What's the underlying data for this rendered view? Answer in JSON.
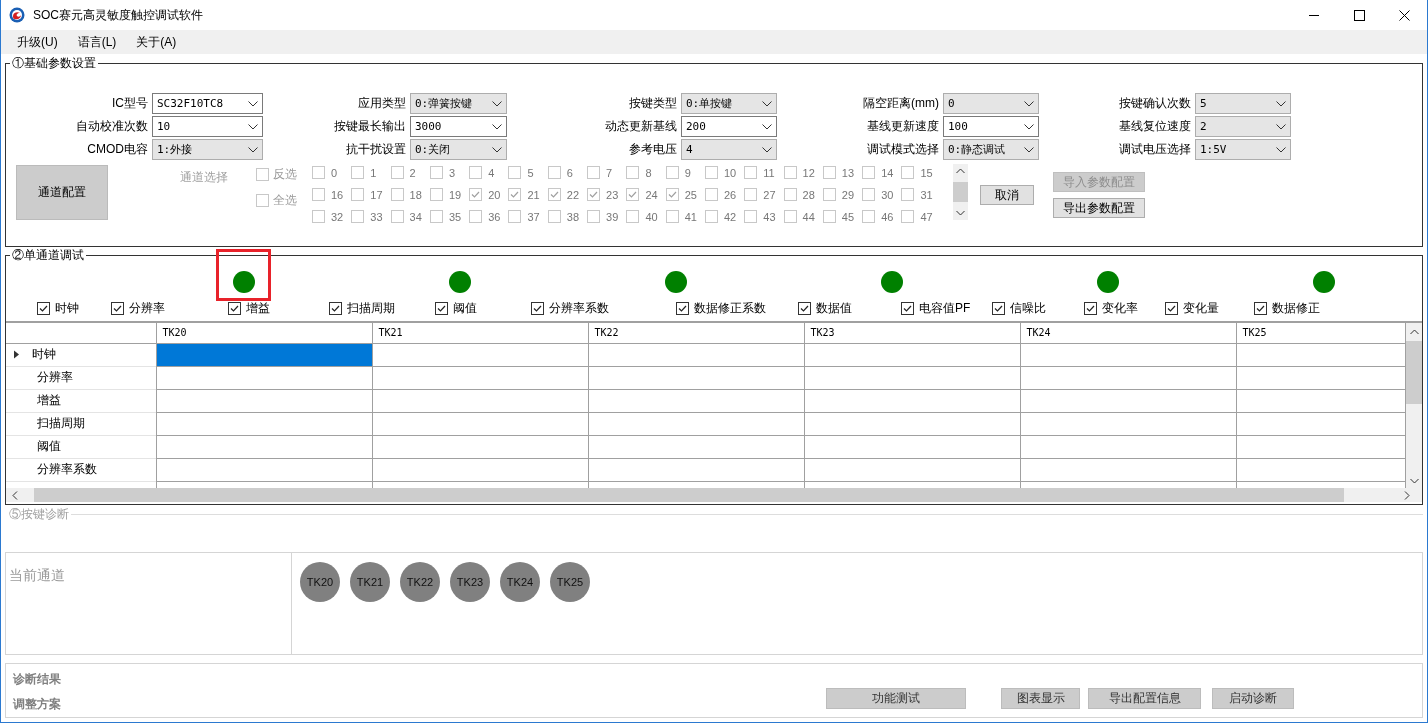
{
  "window": {
    "title": "SOC赛元高灵敏度触控调试软件"
  },
  "menu": [
    {
      "label": "升级(U)"
    },
    {
      "label": "语言(L)"
    },
    {
      "label": "关于(A)"
    }
  ],
  "basic_params": {
    "title": "①基础参数设置",
    "field_columns": [
      [
        {
          "label": "IC型号",
          "value": "SC32F10TC8",
          "editable": true
        },
        {
          "label": "自动校准次数",
          "value": "10",
          "editable": true
        },
        {
          "label": "CMOD电容",
          "value": "1:外接",
          "editable": false
        }
      ],
      [
        {
          "label": "应用类型",
          "value": "0:弹簧按键",
          "editable": false
        },
        {
          "label": "按键最长输出",
          "value": "3000",
          "editable": true
        },
        {
          "label": "抗干扰设置",
          "value": "0:关闭",
          "editable": false
        }
      ],
      [
        {
          "label": "按键类型",
          "value": "0:单按键",
          "editable": false
        },
        {
          "label": "动态更新基线",
          "value": "200",
          "editable": true
        },
        {
          "label": "参考电压",
          "value": "4",
          "editable": false
        }
      ],
      [
        {
          "label": "隔空距离(mm)",
          "value": "0",
          "editable": false
        },
        {
          "label": "基线更新速度",
          "value": "100",
          "editable": true
        },
        {
          "label": "调试模式选择",
          "value": "0:静态调试",
          "editable": false
        }
      ],
      [
        {
          "label": "按键确认次数",
          "value": "5",
          "editable": false
        },
        {
          "label": "基线复位速度",
          "value": "2",
          "editable": false
        },
        {
          "label": "调试电压选择",
          "value": "1:5V",
          "editable": false
        }
      ]
    ],
    "config_button": "通道配置",
    "channel_select_label": "通道选择",
    "select_options": [
      {
        "label": "反选",
        "checked": false,
        "disabled": true
      },
      {
        "label": "全选",
        "checked": false,
        "disabled": true
      }
    ],
    "channels": [
      {
        "label": "0",
        "checked": false
      },
      {
        "label": "1",
        "checked": false
      },
      {
        "label": "2",
        "checked": false
      },
      {
        "label": "3",
        "checked": false
      },
      {
        "label": "4",
        "checked": false
      },
      {
        "label": "5",
        "checked": false
      },
      {
        "label": "6",
        "checked": false
      },
      {
        "label": "7",
        "checked": false
      },
      {
        "label": "8",
        "checked": false
      },
      {
        "label": "9",
        "checked": false
      },
      {
        "label": "10",
        "checked": false
      },
      {
        "label": "11",
        "checked": false
      },
      {
        "label": "12",
        "checked": false
      },
      {
        "label": "13",
        "checked": false
      },
      {
        "label": "14",
        "checked": false
      },
      {
        "label": "15",
        "checked": false
      },
      {
        "label": "16",
        "checked": false
      },
      {
        "label": "17",
        "checked": false
      },
      {
        "label": "18",
        "checked": false
      },
      {
        "label": "19",
        "checked": false
      },
      {
        "label": "20",
        "checked": true
      },
      {
        "label": "21",
        "checked": true
      },
      {
        "label": "22",
        "checked": true
      },
      {
        "label": "23",
        "checked": true
      },
      {
        "label": "24",
        "checked": true
      },
      {
        "label": "25",
        "checked": true
      },
      {
        "label": "26",
        "checked": false
      },
      {
        "label": "27",
        "checked": false
      },
      {
        "label": "28",
        "checked": false
      },
      {
        "label": "29",
        "checked": false
      },
      {
        "label": "30",
        "checked": false
      },
      {
        "label": "31",
        "checked": false
      },
      {
        "label": "32",
        "checked": false
      },
      {
        "label": "33",
        "checked": false
      },
      {
        "label": "34",
        "checked": false
      },
      {
        "label": "35",
        "checked": false
      },
      {
        "label": "36",
        "checked": false
      },
      {
        "label": "37",
        "checked": false
      },
      {
        "label": "38",
        "checked": false
      },
      {
        "label": "39",
        "checked": false
      },
      {
        "label": "40",
        "checked": false
      },
      {
        "label": "41",
        "checked": false
      },
      {
        "label": "42",
        "checked": false
      },
      {
        "label": "43",
        "checked": false
      },
      {
        "label": "44",
        "checked": false
      },
      {
        "label": "45",
        "checked": false
      },
      {
        "label": "46",
        "checked": false
      },
      {
        "label": "47",
        "checked": false
      }
    ],
    "cancel_button": {
      "label": "取消",
      "disabled": false
    },
    "import_button": {
      "label": "导入参数配置",
      "disabled": true
    },
    "export_button": {
      "label": "导出参数配置",
      "disabled": false
    }
  },
  "single_channel_debug": {
    "title": "②单通道调试",
    "indicators": [
      {
        "on": true,
        "highlighted": true
      },
      {
        "on": true,
        "highlighted": false
      },
      {
        "on": true,
        "highlighted": false
      },
      {
        "on": true,
        "highlighted": false
      },
      {
        "on": true,
        "highlighted": false
      },
      {
        "on": true,
        "highlighted": false
      }
    ],
    "options": [
      {
        "label": "时钟",
        "checked": true
      },
      {
        "label": "分辨率",
        "checked": true
      },
      {
        "label": "增益",
        "checked": true
      },
      {
        "label": "扫描周期",
        "checked": true
      },
      {
        "label": "阈值",
        "checked": true
      },
      {
        "label": "分辨率系数",
        "checked": true
      },
      {
        "label": "数据修正系数",
        "checked": true
      },
      {
        "label": "数据值",
        "checked": true
      },
      {
        "label": "电容值PF",
        "checked": true
      },
      {
        "label": "信噪比",
        "checked": true
      },
      {
        "label": "变化率",
        "checked": true
      },
      {
        "label": "变化量",
        "checked": true
      },
      {
        "label": "数据修正",
        "checked": true
      }
    ],
    "table": {
      "columns": [
        "TK20",
        "TK21",
        "TK22",
        "TK23",
        "TK24",
        "TK25"
      ],
      "rows": [
        {
          "label": "时钟",
          "selected": true,
          "cells": [
            {
              "selected": true
            },
            {
              "selected": false
            },
            {
              "selected": false
            },
            {
              "selected": false
            },
            {
              "selected": false
            },
            {
              "selected": false
            }
          ]
        },
        {
          "label": "分辨率",
          "selected": false,
          "cells": [
            {
              "selected": false
            },
            {
              "selected": false
            },
            {
              "selected": false
            },
            {
              "selected": false
            },
            {
              "selected": false
            },
            {
              "selected": false
            }
          ]
        },
        {
          "label": "增益",
          "selected": false,
          "cells": [
            {
              "selected": false
            },
            {
              "selected": false
            },
            {
              "selected": false
            },
            {
              "selected": false
            },
            {
              "selected": false
            },
            {
              "selected": false
            }
          ]
        },
        {
          "label": "扫描周期",
          "selected": false,
          "cells": [
            {
              "selected": false
            },
            {
              "selected": false
            },
            {
              "selected": false
            },
            {
              "selected": false
            },
            {
              "selected": false
            },
            {
              "selected": false
            }
          ]
        },
        {
          "label": "阈值",
          "selected": false,
          "cells": [
            {
              "selected": false
            },
            {
              "selected": false
            },
            {
              "selected": false
            },
            {
              "selected": false
            },
            {
              "selected": false
            },
            {
              "selected": false
            }
          ]
        },
        {
          "label": "分辨率系数",
          "selected": false,
          "cells": [
            {
              "selected": false
            },
            {
              "selected": false
            },
            {
              "selected": false
            },
            {
              "selected": false
            },
            {
              "selected": false
            },
            {
              "selected": false
            }
          ]
        }
      ]
    }
  },
  "key_diagnosis": {
    "title": "⑤按键诊断",
    "current_channel_label": "当前通道",
    "channel_chips": [
      "TK20",
      "TK21",
      "TK22",
      "TK23",
      "TK24",
      "TK25"
    ],
    "result_label": "诊断结果",
    "plan_label": "调整方案",
    "buttons": [
      "功能测试",
      "图表显示",
      "导出配置信息",
      "启动诊断"
    ]
  }
}
